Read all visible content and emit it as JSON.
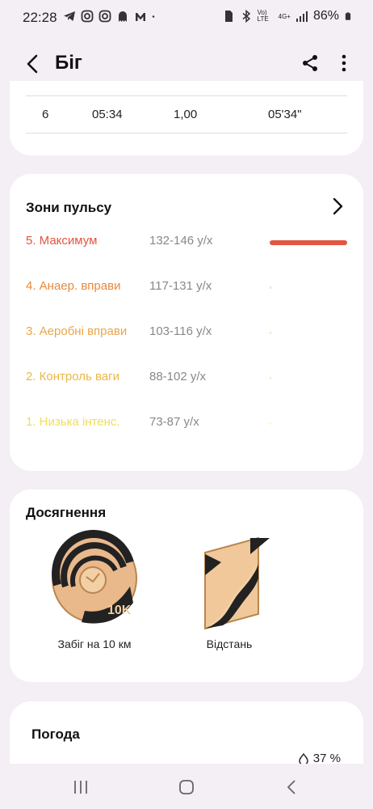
{
  "status_bar": {
    "time": "22:28",
    "battery": "86%",
    "left_icons": [
      "telegram-icon",
      "instagram-icon",
      "instagram-icon",
      "ghost-icon",
      "gmail-m-icon",
      "dot-icon"
    ],
    "right_icons": [
      "sim-icon",
      "bluetooth-icon",
      "volte-icon",
      "4g-icon",
      "signal-icon",
      "battery-icon"
    ],
    "network_label": "4G+",
    "volte_label": "Vo) LTE"
  },
  "header": {
    "title": "Біг"
  },
  "splits": {
    "row": {
      "lap": "6",
      "time": "05:34",
      "distance": "1,00",
      "pace": "05'34\""
    }
  },
  "zones": {
    "title": "Зони пульсу",
    "items": [
      {
        "name": "5. Максимум",
        "range": "132-146 у/х",
        "color": "#e2553f",
        "fraction": 1.0
      },
      {
        "name": "4. Анаер. вправи",
        "range": "117-131 у/х",
        "color": "#e88a3c",
        "fraction": 0.0
      },
      {
        "name": "3. Аеробні вправи",
        "range": "103-116 у/х",
        "color": "#e9a64a",
        "fraction": 0.0
      },
      {
        "name": "2. Контроль ваги",
        "range": "88-102 у/х",
        "color": "#e8b84a",
        "fraction": 0.0
      },
      {
        "name": "1. Низька інтенс.",
        "range": "73-87 у/х",
        "color": "#f0de5a",
        "fraction": 0.0
      }
    ]
  },
  "achievements": {
    "title": "Досягнення",
    "items": [
      {
        "label": "Забіг на 10 км",
        "badge_text": "10K",
        "icon": "10k-run-badge-icon"
      },
      {
        "label": "Відстань",
        "icon": "distance-flag-badge-icon"
      }
    ]
  },
  "weather": {
    "title": "Погода",
    "humidity": "37 %"
  }
}
